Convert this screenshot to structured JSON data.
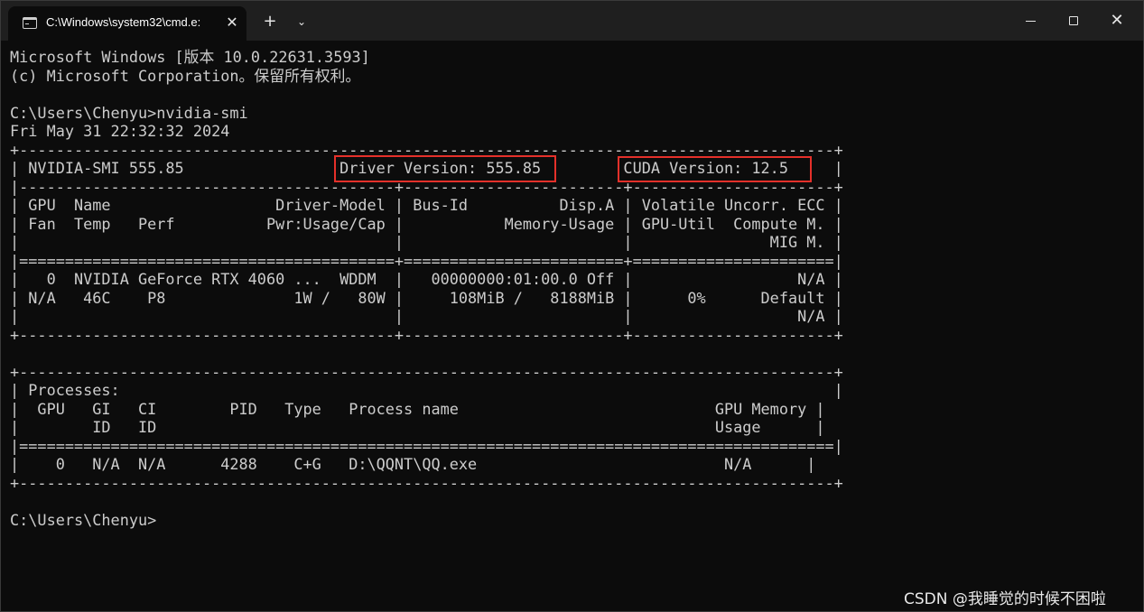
{
  "window": {
    "tab_title": "C:\\Windows\\system32\\cmd.e:",
    "tab_close_glyph": "✕",
    "new_tab_glyph": "+",
    "dropdown_glyph": "⌄",
    "close_glyph": "✕"
  },
  "icons": {
    "tab": "terminal-icon",
    "new_tab": "plus-icon",
    "dropdown": "chevron-down-icon",
    "minimize": "minimize-icon",
    "maximize": "maximize-icon",
    "close": "close-icon"
  },
  "colors": {
    "background": "#0c0c0c",
    "titlebar": "#1f1f1f",
    "text": "#cccccc",
    "highlight_box": "#e5302a"
  },
  "terminal": {
    "lines": [
      "Microsoft Windows [版本 10.0.22631.3593]",
      "(c) Microsoft Corporation。保留所有权利。",
      "",
      "C:\\Users\\Chenyu>nvidia-smi",
      "Fri May 31 22:32:32 2024",
      "+-----------------------------------------------------------------------------------------+",
      "| NVIDIA-SMI 555.85                 Driver Version: 555.85         CUDA Version: 12.5     |",
      "|-----------------------------------------+------------------------+----------------------+",
      "| GPU  Name                  Driver-Model | Bus-Id          Disp.A | Volatile Uncorr. ECC |",
      "| Fan  Temp   Perf          Pwr:Usage/Cap |           Memory-Usage | GPU-Util  Compute M. |",
      "|                                         |                        |               MIG M. |",
      "|=========================================+========================+======================|",
      "|   0  NVIDIA GeForce RTX 4060 ...  WDDM  |   00000000:01:00.0 Off |                  N/A |",
      "| N/A   46C    P8              1W /   80W |     108MiB /   8188MiB |      0%      Default |",
      "|                                         |                        |                  N/A |",
      "+-----------------------------------------+------------------------+----------------------+",
      "",
      "+-----------------------------------------------------------------------------------------+",
      "| Processes:                                                                              |",
      "|  GPU   GI   CI        PID   Type   Process name                            GPU Memory |",
      "|        ID   ID                                                             Usage      |",
      "|=========================================================================================|",
      "|    0   N/A  N/A      4288    C+G   D:\\QQNT\\QQ.exe                           N/A      |",
      "+-----------------------------------------------------------------------------------------+",
      "",
      "C:\\Users\\Chenyu>"
    ]
  },
  "watermark": "CSDN @我睡觉的时候不困啦"
}
